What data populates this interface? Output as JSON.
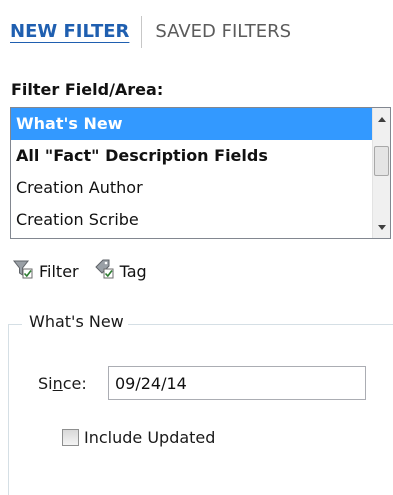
{
  "tabs": [
    {
      "label": "NEW FILTER",
      "active": true
    },
    {
      "label": "SAVED FILTERS",
      "active": false
    }
  ],
  "filter_field": {
    "label": "Filter Field/Area:",
    "items": [
      {
        "label": "What's New",
        "selected": true,
        "bold": true
      },
      {
        "label": "All \"Fact\" Description Fields",
        "selected": false,
        "bold": true
      },
      {
        "label": "Creation Author",
        "selected": false,
        "bold": false
      },
      {
        "label": "Creation Scribe",
        "selected": false,
        "bold": false
      }
    ]
  },
  "toolbar": {
    "filter_label": "Filter",
    "filter_icon": "filter-icon",
    "tag_label": "Tag",
    "tag_icon": "tag-icon"
  },
  "group": {
    "title": "What's New",
    "since_prefix": "Si",
    "since_accel": "n",
    "since_suffix": "ce:",
    "since_value": "09/24/14",
    "include_updated_label": "Include Updated",
    "include_updated_checked": false
  },
  "colors": {
    "accent": "#1f5fb0",
    "selection": "#3399ff"
  }
}
